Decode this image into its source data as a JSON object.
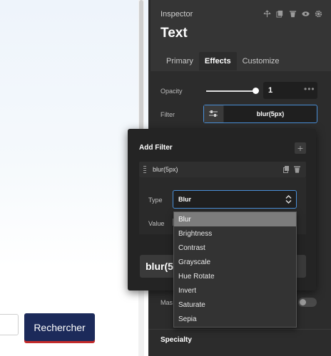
{
  "canvas": {
    "search_button_label": "Rechercher"
  },
  "inspector": {
    "header_label": "Inspector",
    "element_title": "Text",
    "tabs": [
      {
        "label": "Primary"
      },
      {
        "label": "Effects"
      },
      {
        "label": "Customize"
      }
    ],
    "active_tab": "Effects",
    "opacity": {
      "label": "Opacity",
      "value": "1",
      "slider_fraction": 1.0
    },
    "filter": {
      "label": "Filter",
      "value": "blur(5px)"
    },
    "mask_label": "Mas",
    "specialty_label": "Specialty"
  },
  "add_filter_popup": {
    "title": "Add Filter",
    "item_label": "blur(5px)",
    "type_label": "Type",
    "type_value": "Blur",
    "value_label": "Value",
    "preview_text": "blur(5p"
  },
  "type_dropdown": {
    "options": [
      "Blur",
      "Brightness",
      "Contrast",
      "Grayscale",
      "Hue Rotate",
      "Invert",
      "Saturate",
      "Sepia"
    ],
    "selected": "Blur"
  },
  "colors": {
    "accent_blue": "#4a90d9",
    "panel_bg": "#353535",
    "search_button_bg": "#1c2a5a",
    "search_button_underline": "#c42b2b"
  }
}
